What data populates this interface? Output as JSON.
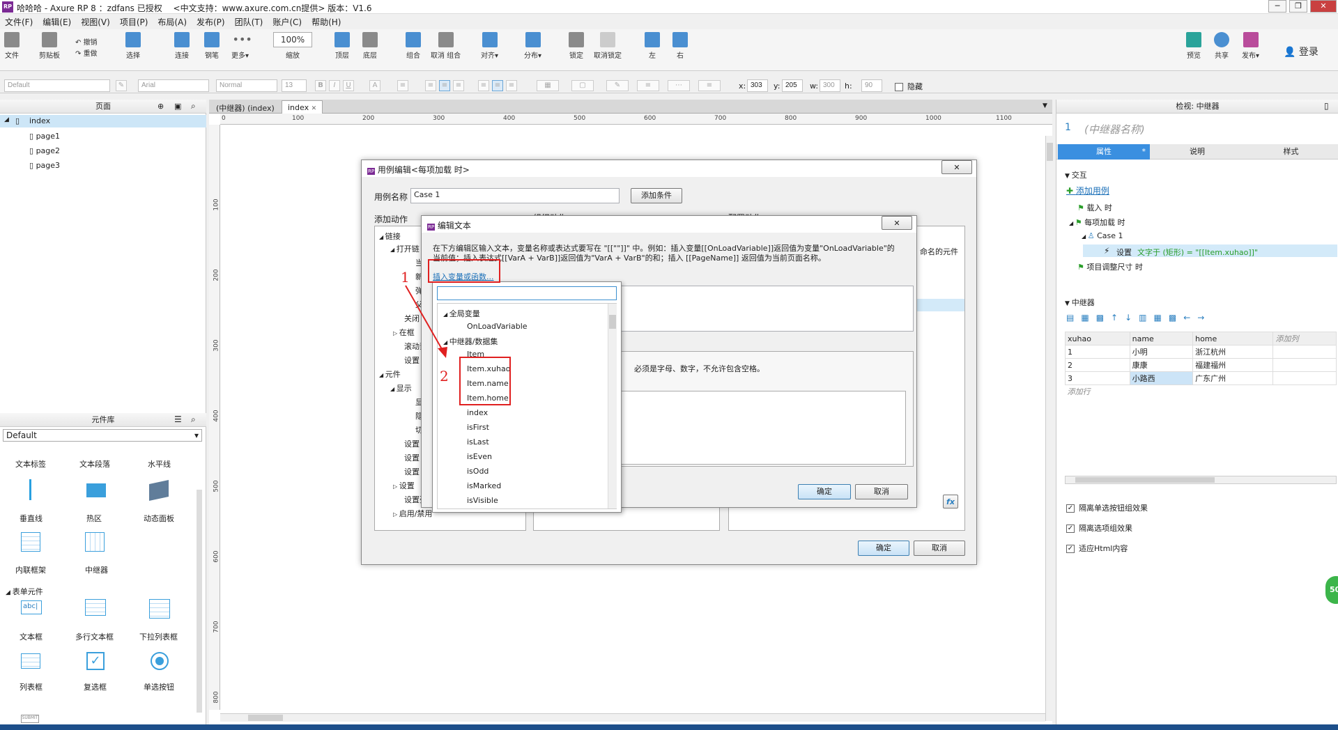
{
  "window": {
    "title": "哈哈哈 - Axure RP 8 ：zdfans 已授权　 <中文支持：www.axure.com.cn提供> 版本：V1.6",
    "logo": "RP",
    "min": "─",
    "max": "❐",
    "close": "✕"
  },
  "menu": [
    "文件(F)",
    "编辑(E)",
    "视图(V)",
    "项目(P)",
    "布局(A)",
    "发布(P)",
    "团队(T)",
    "账户(C)",
    "帮助(H)"
  ],
  "toolbar": {
    "file": "文件",
    "clipboard": "剪贴板",
    "undo": "撤销",
    "redo": "重做",
    "select": "选择",
    "connect": "连接",
    "pen": "钢笔",
    "more": "更多▾",
    "zoom": "100%",
    "zoom_label": "缩放",
    "top": "顶层",
    "bottom": "底层",
    "group": "组合",
    "ungroup": "取消 组合",
    "align": "对齐▾",
    "distribute": "分布▾",
    "lock": "锁定",
    "unlock": "取消锁定",
    "left": "左",
    "right": "右",
    "preview": "预览",
    "share": "共享",
    "publish": "发布▾",
    "login": "登录"
  },
  "format": {
    "style": "Default",
    "font": "Arial",
    "weight": "Normal",
    "size": "13",
    "x_label": "x:",
    "x": "303",
    "y_label": "y:",
    "y": "205",
    "w_label": "w:",
    "w": "300",
    "h_label": "h:",
    "h": "90",
    "hidden": "隐藏"
  },
  "pages": {
    "header": "页面",
    "items": [
      "index",
      "page1",
      "page2",
      "page3"
    ]
  },
  "library": {
    "header": "元件库",
    "select": "Default",
    "row1": [
      "文本标签",
      "文本段落",
      "水平线"
    ],
    "row2": [
      "垂直线",
      "热区",
      "动态面板"
    ],
    "row3": [
      "内联框架",
      "中继器"
    ],
    "section": "表单元件",
    "row4": [
      "文本框",
      "多行文本框",
      "下拉列表框"
    ],
    "row5": [
      "列表框",
      "复选框",
      "单选按钮"
    ],
    "abc": "abc|",
    "submit": "SUBMIT"
  },
  "canvas": {
    "tabs": [
      "(中继器) (index)",
      "index"
    ],
    "tab_close": "✕",
    "ruler_h": [
      "0",
      "100",
      "200",
      "300",
      "400",
      "500",
      "600",
      "700",
      "800",
      "900",
      "1000",
      "1100"
    ],
    "ruler_v": [
      "100",
      "200",
      "300",
      "400",
      "500",
      "600",
      "700",
      "800"
    ]
  },
  "case_dialog": {
    "title": "用例编辑<每项加载 时>",
    "name_label": "用例名称",
    "name_value": "Case 1",
    "add_condition": "添加条件",
    "add_action": "添加动作",
    "organize": "组织动作",
    "configure": "配置动作",
    "tree": [
      "链接",
      "打开链",
      "当",
      "新",
      "弹",
      "父",
      "关闭",
      "在框",
      "滚动到",
      "设置",
      "元件",
      "显示",
      "显",
      "隐",
      "切",
      "设置",
      "设置",
      "设置",
      "设置",
      "设置列表选中项",
      "启用/禁用"
    ],
    "named": "命名的元件",
    "ok": "确定",
    "cancel": "取消"
  },
  "edit_text": {
    "title": "编辑文本",
    "desc1": "在下方编辑区输入文本，变量名称或表达式要写在 \"[[\"\"]]\" 中。例如：插入变量[[OnLoadVariable]]返回值为变量\"OnLoadVariable\"的",
    "desc2": "当前值；插入表达式[[VarA + VarB]]返回值为\"VarA + VarB\"的和；插入 [[PageName]] 返回值为当前页面名称。",
    "insert": "插入变量或函数...",
    "note": "必须是字母、数字，不允许包含空格。",
    "ok": "确定",
    "cancel": "取消",
    "fx": "fx"
  },
  "var_list": {
    "global": "全局变量",
    "onload": "OnLoadVariable",
    "repeater": "中继器/数据集",
    "items": [
      "Item",
      "Item.xuhao",
      "Item.name",
      "Item.home",
      "index",
      "isFirst",
      "isLast",
      "isEven",
      "isOdd",
      "isMarked",
      "isVisible"
    ]
  },
  "annotations": {
    "one": "1",
    "two": "2"
  },
  "inspector": {
    "header": "检视: 中继器",
    "num": "1",
    "name": "(中继器名称)",
    "tabs": [
      "属性",
      "说明",
      "样式"
    ],
    "tab_marker": "*",
    "interaction": "交互",
    "add_case": "添加用例",
    "events": [
      "载入 时",
      "每项加载 时",
      "Case 1",
      "项目调整尺寸 时"
    ],
    "action_prefix": "设置",
    "action_body": "文字于 (矩形) = \"[[Item.xuhao]]\"",
    "repeater": "中继器",
    "columns": [
      "xuhao",
      "name",
      "home",
      "添加列"
    ],
    "rows": [
      [
        "1",
        "小明",
        "浙江杭州"
      ],
      [
        "2",
        "康康",
        "福建福州"
      ],
      [
        "3",
        "小路西",
        "广东广州"
      ]
    ],
    "add_row": "添加行",
    "options": [
      "隔离单选按钮组效果",
      "隔离选项组效果",
      "适应Html内容"
    ],
    "badge": "50"
  }
}
